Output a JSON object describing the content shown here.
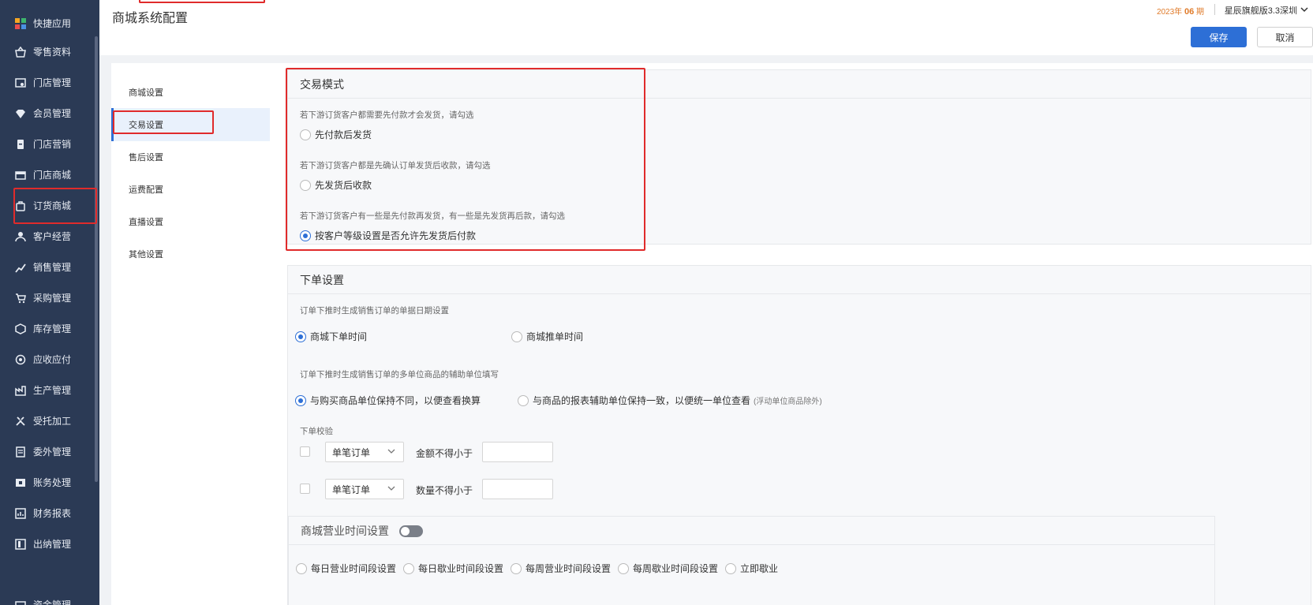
{
  "nav": {
    "items": [
      {
        "label": "快捷应用",
        "icon": "apps-icon"
      },
      {
        "label": "零售资料",
        "icon": "basket-icon"
      },
      {
        "label": "门店管理",
        "icon": "store-icon"
      },
      {
        "label": "会员管理",
        "icon": "diamond-icon"
      },
      {
        "label": "门店营销",
        "icon": "marketing-icon"
      },
      {
        "label": "门店商城",
        "icon": "shop-icon"
      },
      {
        "label": "订货商城",
        "icon": "order-bag-icon"
      },
      {
        "label": "客户经营",
        "icon": "customer-icon"
      },
      {
        "label": "销售管理",
        "icon": "sales-icon"
      },
      {
        "label": "采购管理",
        "icon": "cart-icon"
      },
      {
        "label": "库存管理",
        "icon": "box-icon"
      },
      {
        "label": "应收应付",
        "icon": "finance-icon"
      },
      {
        "label": "生产管理",
        "icon": "factory-icon"
      },
      {
        "label": "受托加工",
        "icon": "tools-icon"
      },
      {
        "label": "委外管理",
        "icon": "outsource-icon"
      },
      {
        "label": "账务处理",
        "icon": "ledger-icon"
      },
      {
        "label": "财务报表",
        "icon": "report-icon"
      },
      {
        "label": "出纳管理",
        "icon": "cashier-icon"
      },
      {
        "label": "资金管理",
        "icon": "fund-icon"
      }
    ]
  },
  "header": {
    "title": "商城系统配置",
    "edition_year": "2023年",
    "edition_period": "06",
    "edition_suffix": "期",
    "company": "星辰旗舰版3.3深圳",
    "save_label": "保存",
    "cancel_label": "取消"
  },
  "submenu": {
    "items": [
      "商城设置",
      "交易设置",
      "售后设置",
      "运费配置",
      "直播设置",
      "其他设置"
    ],
    "active": "交易设置"
  },
  "trade_mode": {
    "title": "交易模式",
    "hint1": "若下游订货客户都需要先付款才会发货，请勾选",
    "opt1": "先付款后发货",
    "hint2": "若下游订货客户都是先确认订单发货后收款，请勾选",
    "opt2": "先发货后收款",
    "hint3": "若下游订货客户有一些是先付款再发货，有一些是先发货再后款，请勾选",
    "opt3": "按客户等级设置是否允许先发货后付款"
  },
  "order_settings": {
    "title": "下单设置",
    "date_hint": "订单下推时生成销售订单的单据日期设置",
    "date_opt1": "商城下单时间",
    "date_opt2": "商城推单时间",
    "unit_hint": "订单下推时生成销售订单的多单位商品的辅助单位填写",
    "unit_opt1": "与购买商品单位保持不同，以便查看换算",
    "unit_opt2": "与商品的报表辅助单位保持一致，以便统一单位查看",
    "unit_opt2_note": "(浮动单位商品除外)",
    "check_title": "下单校验",
    "row1_select": "单笔订单",
    "row1_label": "金额不得小于",
    "row2_select": "单笔订单",
    "row2_label": "数量不得小于"
  },
  "business_hours": {
    "title": "商城营业时间设置",
    "options": [
      "每日营业时间段设置",
      "每日歇业时间段设置",
      "每周营业时间段设置",
      "每周歇业时间段设置",
      "立即歇业"
    ]
  },
  "colors": {
    "accent": "#2d6fd6",
    "nav_bg": "#2b3a55",
    "highlight": "#e02b2b"
  }
}
